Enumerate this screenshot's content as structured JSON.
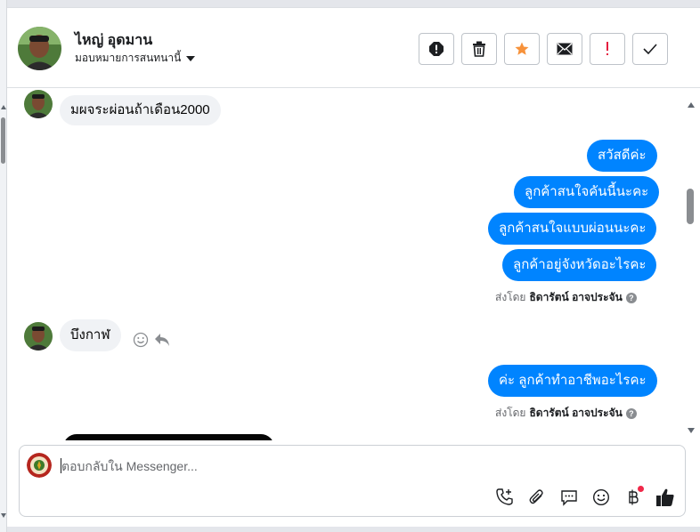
{
  "conversation": {
    "name": "ไหญ่ อุดมาน",
    "assign_label": "มอบหมายการสนทนานี้"
  },
  "actions": [
    {
      "name": "mark-spam-icon"
    },
    {
      "name": "trash-icon"
    },
    {
      "name": "star-icon",
      "color": "#f7923a"
    },
    {
      "name": "mark-unread-icon"
    },
    {
      "name": "follow-up-icon",
      "color": "#e41e3f"
    },
    {
      "name": "mark-done-icon"
    }
  ],
  "messages": {
    "in_1": "มผจระผ่อนถ้าเดือน2000",
    "out_1": "สวัสดีค่ะ",
    "out_2": "ลูกค้าสนใจคันนี้นะคะ",
    "out_3": "ลูกค้าสนใจแบบผ่อนนะคะ",
    "out_4": "ลูกค้าอยู่จังหวัดอะไรคะ",
    "in_2": "บึงกาฬ",
    "out_5": "ค่ะ ลูกค้าทำอาชีพอะไรคะ"
  },
  "sent_by": {
    "prefix": "ส่งโดย",
    "agent": "ธิดารัตน์ อาจประจัน"
  },
  "composer": {
    "placeholder": "ตอบกลับใน Messenger..."
  },
  "colors": {
    "outgoing_bubble": "#0084ff",
    "incoming_bubble": "#f0f2f5",
    "star": "#f7923a",
    "follow_up": "#e41e3f",
    "notification_dot": "#f02849"
  }
}
